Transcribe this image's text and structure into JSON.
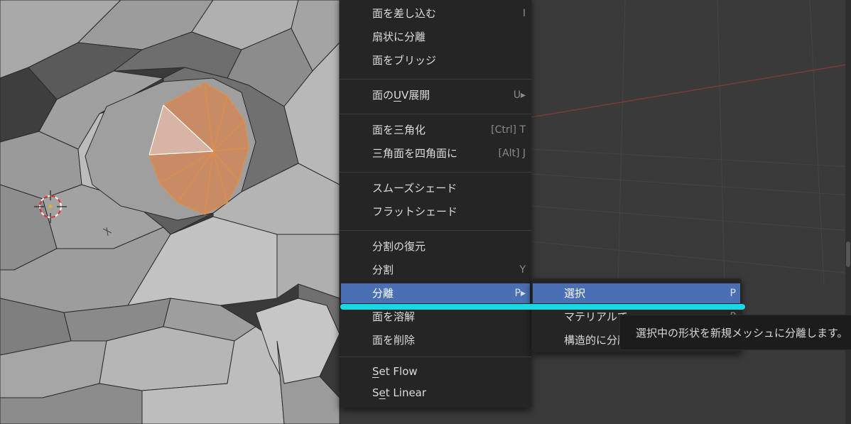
{
  "face_menu": {
    "items": [
      {
        "label": "面を差し込む",
        "shortcut": "I"
      },
      {
        "label": "扇状に分離",
        "shortcut": ""
      },
      {
        "label": "面をブリッジ",
        "shortcut": ""
      },
      {
        "label_prefix": "面の",
        "label_ul": "U",
        "label_suffix": "V展開",
        "shortcut": "U▸"
      },
      {
        "label": "面を三角化",
        "shortcut": "[Ctrl] T"
      },
      {
        "label": "三角面を四角面に",
        "shortcut": "[Alt] J"
      },
      {
        "label": "スムーズシェード",
        "shortcut": ""
      },
      {
        "label": "フラットシェード",
        "shortcut": ""
      },
      {
        "label": "分割の復元",
        "shortcut": ""
      },
      {
        "label": "分割",
        "shortcut": "Y"
      },
      {
        "label": "分離",
        "shortcut": "P▸"
      },
      {
        "label": "面を溶解",
        "shortcut": ""
      },
      {
        "label": "面を削除",
        "shortcut": ""
      },
      {
        "label_ul": "S",
        "label_suffix": "et Flow",
        "shortcut": ""
      },
      {
        "label_prefix": "S",
        "label_ul": "e",
        "label_suffix": "t Linear",
        "shortcut": ""
      }
    ]
  },
  "separate_submenu": {
    "items": [
      {
        "label": "選択",
        "shortcut": "P"
      },
      {
        "label": "マテリアルで",
        "shortcut": "P"
      },
      {
        "label": "構造的に分離したパーツで",
        "shortcut": ""
      }
    ]
  },
  "tooltip": {
    "text": "選択中の形状を新規メッシュに分離します。"
  },
  "colors": {
    "menu_bg": "#252525",
    "active": "#4b6fb3",
    "highlight_line": "#19d7e3",
    "selected_faces": "#c98a66"
  }
}
